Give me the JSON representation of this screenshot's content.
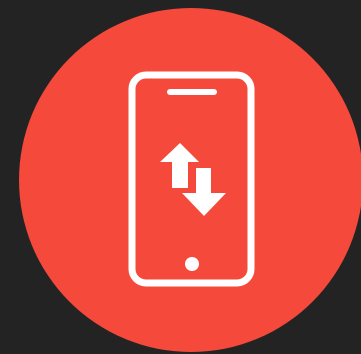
{
  "colors": {
    "background": "#232323",
    "circle": "#F5493C",
    "icon": "#FFFFFF"
  },
  "icons": {
    "badge": "circle-badge",
    "device": "smartphone-icon",
    "action": "data-transfer-arrows-icon"
  }
}
